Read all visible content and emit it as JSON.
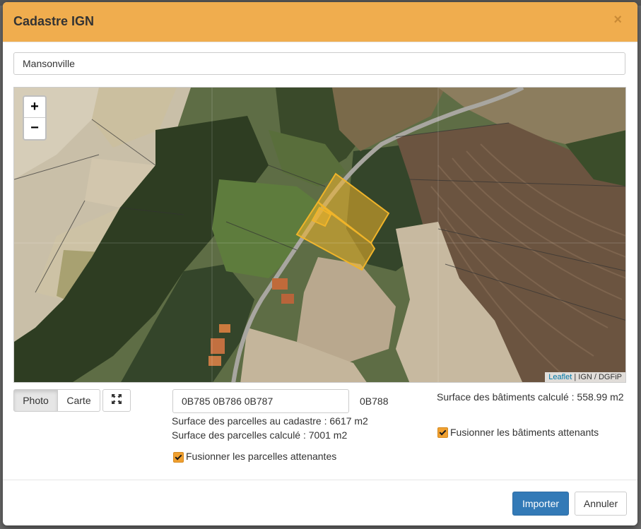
{
  "modal": {
    "title": "Cadastre IGN",
    "close_icon": "close-icon",
    "close_symbol": "×"
  },
  "search": {
    "value": "Mansonville"
  },
  "map": {
    "zoom_in": "+",
    "zoom_out": "−",
    "attribution_link": "Leaflet",
    "attribution_text": " | IGN / DGFiP",
    "selection_color": "#f0b429"
  },
  "layers": {
    "photo_label": "Photo",
    "carte_label": "Carte",
    "fullscreen_icon": "expand-icon",
    "selected": "Photo"
  },
  "parcels": {
    "selected_value": "0B785 0B786 0B787",
    "hover_label": "0B788",
    "surface_cadastre": "Surface des parcelles au cadastre : 6617 m2",
    "surface_calcule": "Surface des parcelles calculé : 7001 m2",
    "merge_label": "Fusionner les parcelles attenantes",
    "merge_checked": true
  },
  "buildings": {
    "surface_calcule": "Surface des bâtiments calculé : 558.99 m2",
    "merge_label": "Fusionner les bâtiments attenants",
    "merge_checked": true
  },
  "footer": {
    "import_label": "Importer",
    "cancel_label": "Annuler"
  },
  "colors": {
    "header": "#f0ad4e",
    "primary": "#337ab7",
    "checkbox": "#f0a030"
  }
}
